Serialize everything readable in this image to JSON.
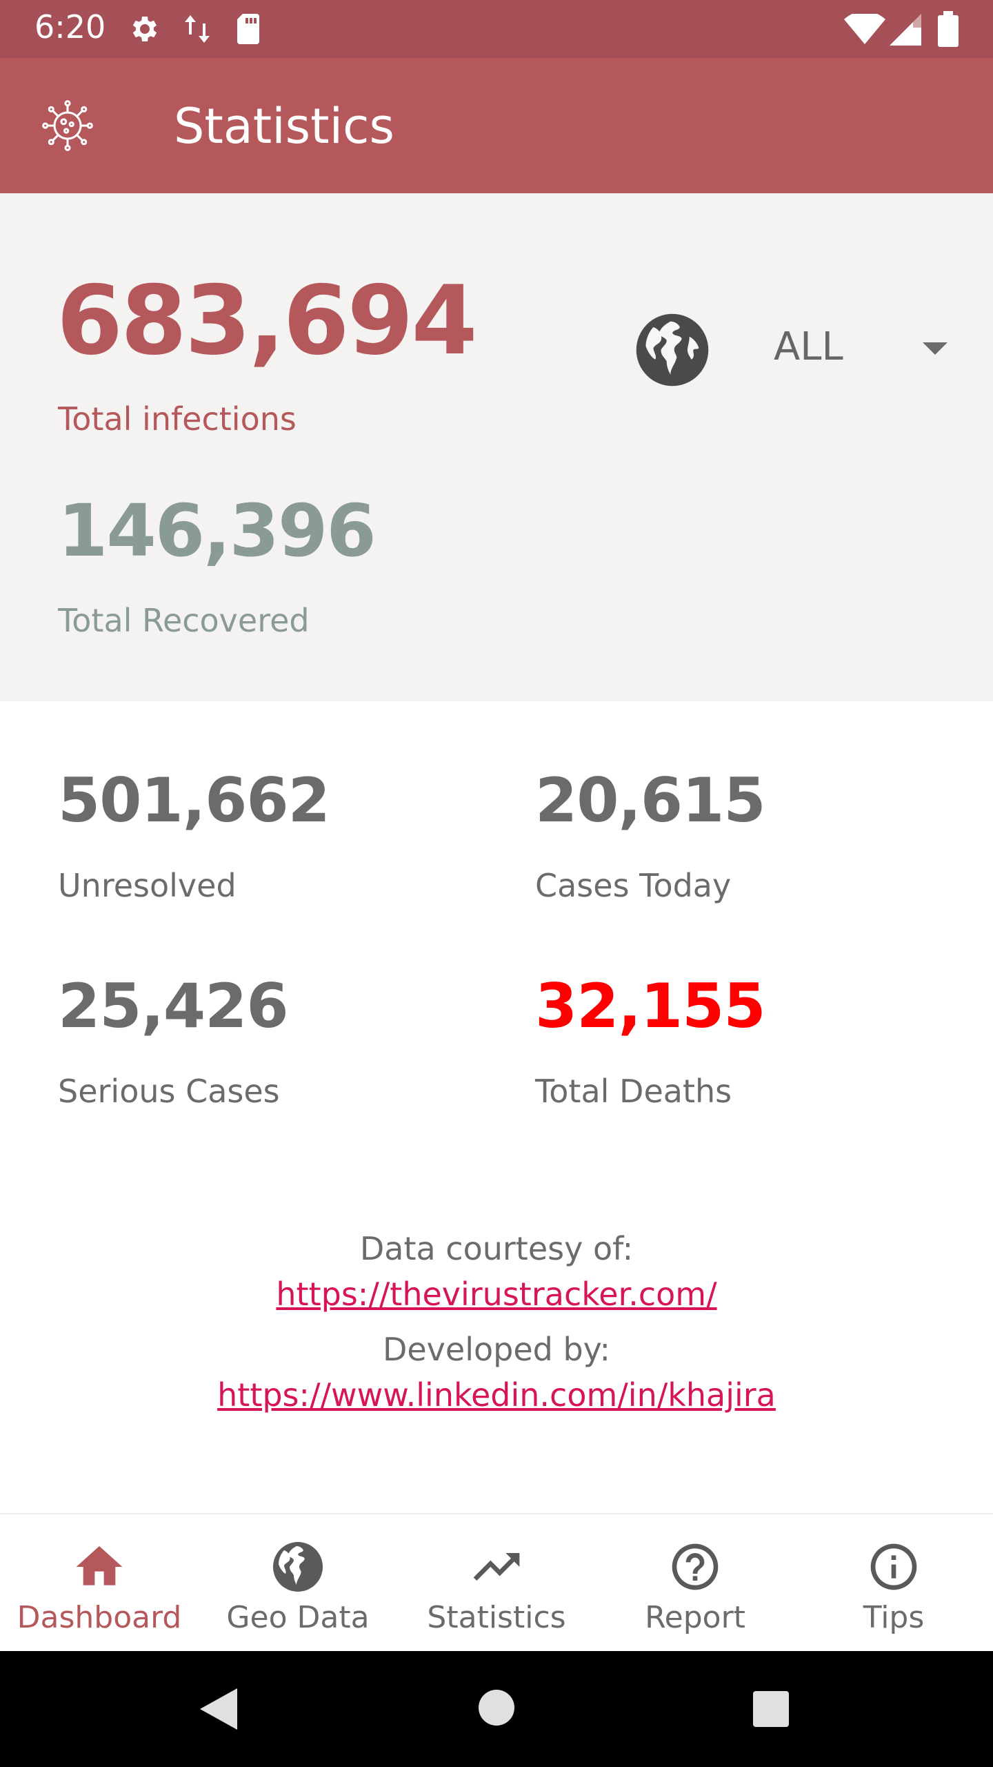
{
  "status_bar": {
    "time": "6:20",
    "icons": [
      "gear-icon",
      "data-transfer-icon",
      "sd-card-icon",
      "wifi-icon",
      "signal-icon",
      "battery-icon"
    ]
  },
  "app_bar": {
    "title": "Statistics",
    "logo_icon": "virus-icon"
  },
  "summary": {
    "total_infections": "683,694",
    "total_infections_label": "Total infections",
    "total_recovered": "146,396",
    "total_recovered_label": "Total Recovered",
    "region": "ALL"
  },
  "stats": {
    "unresolved": "501,662",
    "unresolved_label": "Unresolved",
    "cases_today": "20,615",
    "cases_today_label": "Cases Today",
    "serious_cases": "25,426",
    "serious_cases_label": "Serious Cases",
    "total_deaths": "32,155",
    "total_deaths_label": "Total Deaths"
  },
  "credits": {
    "data_label": "Data courtesy of:",
    "data_link": "https://thevirustracker.com/",
    "dev_label": "Developed by:",
    "dev_link": "https://www.linkedin.com/in/khajira"
  },
  "bottom_nav": {
    "items": [
      {
        "label": "Dashboard",
        "icon": "home-icon",
        "active": true
      },
      {
        "label": "Geo Data",
        "icon": "globe-icon",
        "active": false
      },
      {
        "label": "Statistics",
        "icon": "trending-up-icon",
        "active": false
      },
      {
        "label": "Report",
        "icon": "help-circle-icon",
        "active": false
      },
      {
        "label": "Tips",
        "icon": "info-circle-icon",
        "active": false
      }
    ]
  },
  "colors": {
    "status_bar": "#a55056",
    "app_bar": "#b5585c",
    "accent": "#b5585c",
    "recovered": "#8a9a97",
    "deaths": "#ff0000",
    "link": "#d6145a"
  }
}
